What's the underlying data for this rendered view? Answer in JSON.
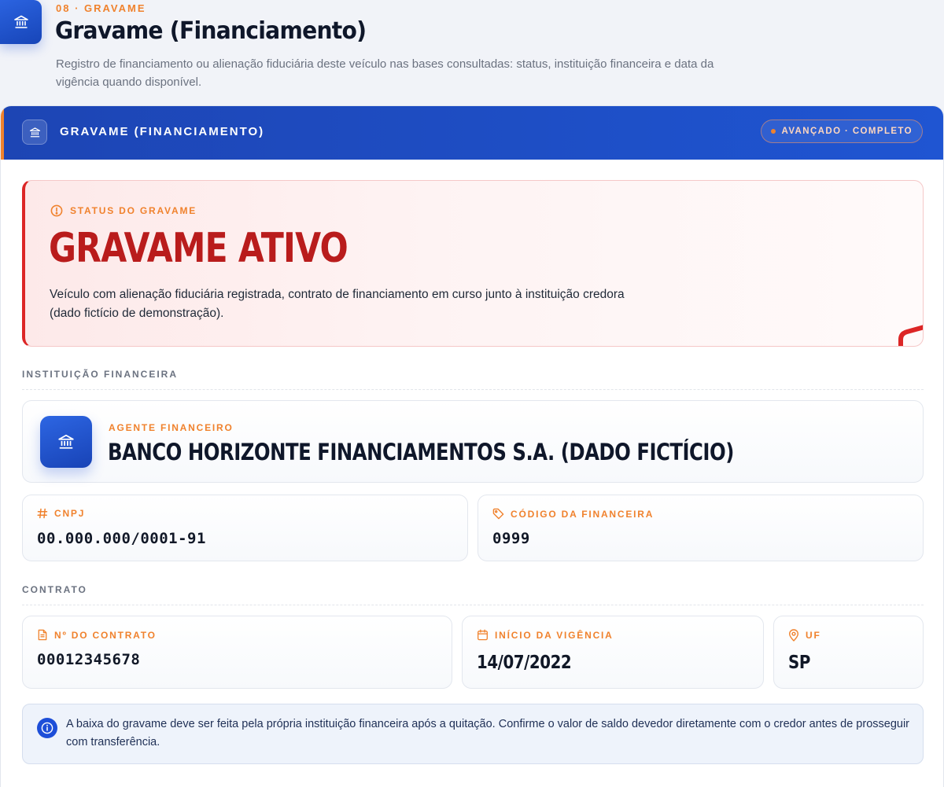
{
  "header": {
    "eyebrow": "08 · GRAVAME",
    "title": "Gravame (Financiamento)",
    "description": "Registro de financiamento ou alienação fiduciária deste veículo nas bases consultadas: status, instituição financeira e data da vigência quando disponível.",
    "icon": "bank-icon"
  },
  "card": {
    "bar_title": "GRAVAME (FINANCIAMENTO)",
    "badge": "AVANÇADO · COMPLETO",
    "accent_color": "#1f4fcc",
    "badge_dot_color": "#f0822d"
  },
  "status": {
    "label": "STATUS DO GRAVAME",
    "value": "GRAVAME ATIVO",
    "description": "Veículo com alienação fiduciária registrada, contrato de financiamento em curso junto à instituição credora (dado fictício de demonstração).",
    "color": "#b91c1c",
    "icon": "alert-circle-icon"
  },
  "institution": {
    "section_label": "INSTITUIÇÃO FINANCEIRA",
    "agent_label": "AGENTE FINANCEIRO",
    "agent_name": "BANCO HORIZONTE FINANCIAMENTOS S.A. (DADO FICTÍCIO)",
    "cnpj_label": "CNPJ",
    "cnpj_value": "00.000.000/0001-91",
    "code_label": "CÓDIGO DA FINANCEIRA",
    "code_value": "0999"
  },
  "contract": {
    "section_label": "CONTRATO",
    "number_label": "Nº DO CONTRATO",
    "number_value": "00012345678",
    "start_label": "INÍCIO DA VIGÊNCIA",
    "start_value": "14/07/2022",
    "uf_label": "UF",
    "uf_value": "SP"
  },
  "note": {
    "text": "A baixa do gravame deve ser feita pela própria instituição financeira após a quitação. Confirme o valor de saldo devedor diretamente com o credor antes de prosseguir com transferência.",
    "icon": "info-icon"
  }
}
